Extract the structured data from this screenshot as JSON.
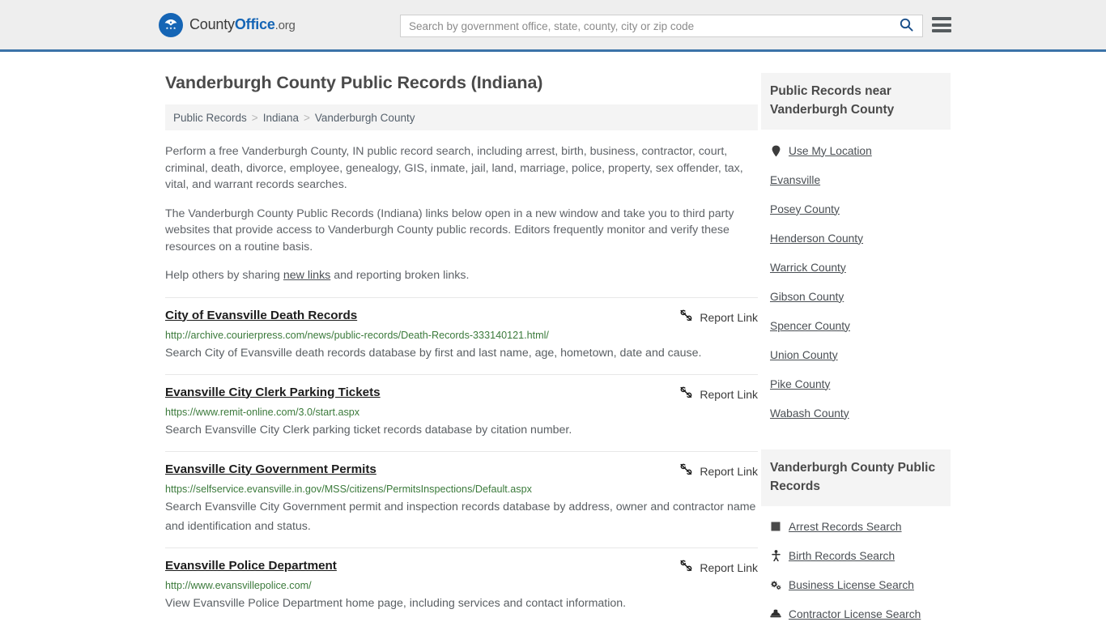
{
  "header": {
    "brand": {
      "county": "County",
      "office": "Office",
      "org": ".org"
    },
    "search": {
      "placeholder": "Search by government office, state, county, city or zip code",
      "value": ""
    },
    "search_icon": "search-icon",
    "menu_icon": "hamburger-menu-icon",
    "accent_color": "#3b73a8"
  },
  "page_title": "Vanderburgh County Public Records (Indiana)",
  "breadcrumb": {
    "items": [
      "Public Records",
      "Indiana",
      "Vanderburgh County"
    ],
    "separator": ">"
  },
  "intro": {
    "p1": "Perform a free Vanderburgh County, IN public record search, including arrest, birth, business, contractor, court, criminal, death, divorce, employee, genealogy, GIS, inmate, jail, land, marriage, police, property, sex offender, tax, vital, and warrant records searches.",
    "p2": "The Vanderburgh County Public Records (Indiana) links below open in a new window and take you to third party websites that provide access to Vanderburgh County public records. Editors frequently monitor and verify these resources on a routine basis.",
    "p3_before": "Help others by sharing ",
    "p3_link": "new links",
    "p3_after": " and reporting broken links."
  },
  "report_link_label": "Report Link",
  "report_link_icon": "broken-link-icon",
  "results": [
    {
      "title": "City of Evansville Death Records",
      "url": "http://archive.courierpress.com/news/public-records/Death-Records-333140121.html/",
      "description": "Search City of Evansville death records database by first and last name, age, hometown, date and cause."
    },
    {
      "title": "Evansville City Clerk Parking Tickets",
      "url": "https://www.remit-online.com/3.0/start.aspx",
      "description": "Search Evansville City Clerk parking ticket records database by citation number."
    },
    {
      "title": "Evansville City Government Permits",
      "url": "https://selfservice.evansville.in.gov/MSS/citizens/PermitsInspections/Default.aspx",
      "description": "Search Evansville City Government permit and inspection records database by address, owner and contractor name and identification and status."
    },
    {
      "title": "Evansville Police Department",
      "url": "http://www.evansvillepolice.com/",
      "description": "View Evansville Police Department home page, including services and contact information."
    }
  ],
  "sidebar": {
    "near_panel": {
      "title": "Public Records near Vanderburgh County",
      "items": [
        {
          "label": "Use My Location",
          "icon": "map-pin-icon"
        },
        {
          "label": "Evansville",
          "icon": ""
        },
        {
          "label": "Posey County",
          "icon": ""
        },
        {
          "label": "Henderson County",
          "icon": ""
        },
        {
          "label": "Warrick County",
          "icon": ""
        },
        {
          "label": "Gibson County",
          "icon": ""
        },
        {
          "label": "Spencer County",
          "icon": ""
        },
        {
          "label": "Union County",
          "icon": ""
        },
        {
          "label": "Pike County",
          "icon": ""
        },
        {
          "label": "Wabash County",
          "icon": ""
        }
      ]
    },
    "records_panel": {
      "title": "Vanderburgh County Public Records",
      "items": [
        {
          "label": "Arrest Records Search",
          "icon": "square-icon"
        },
        {
          "label": "Birth Records Search",
          "icon": "child-icon"
        },
        {
          "label": "Business License Search",
          "icon": "gears-icon"
        },
        {
          "label": "Contractor License Search",
          "icon": "hard-hat-icon"
        }
      ]
    }
  }
}
